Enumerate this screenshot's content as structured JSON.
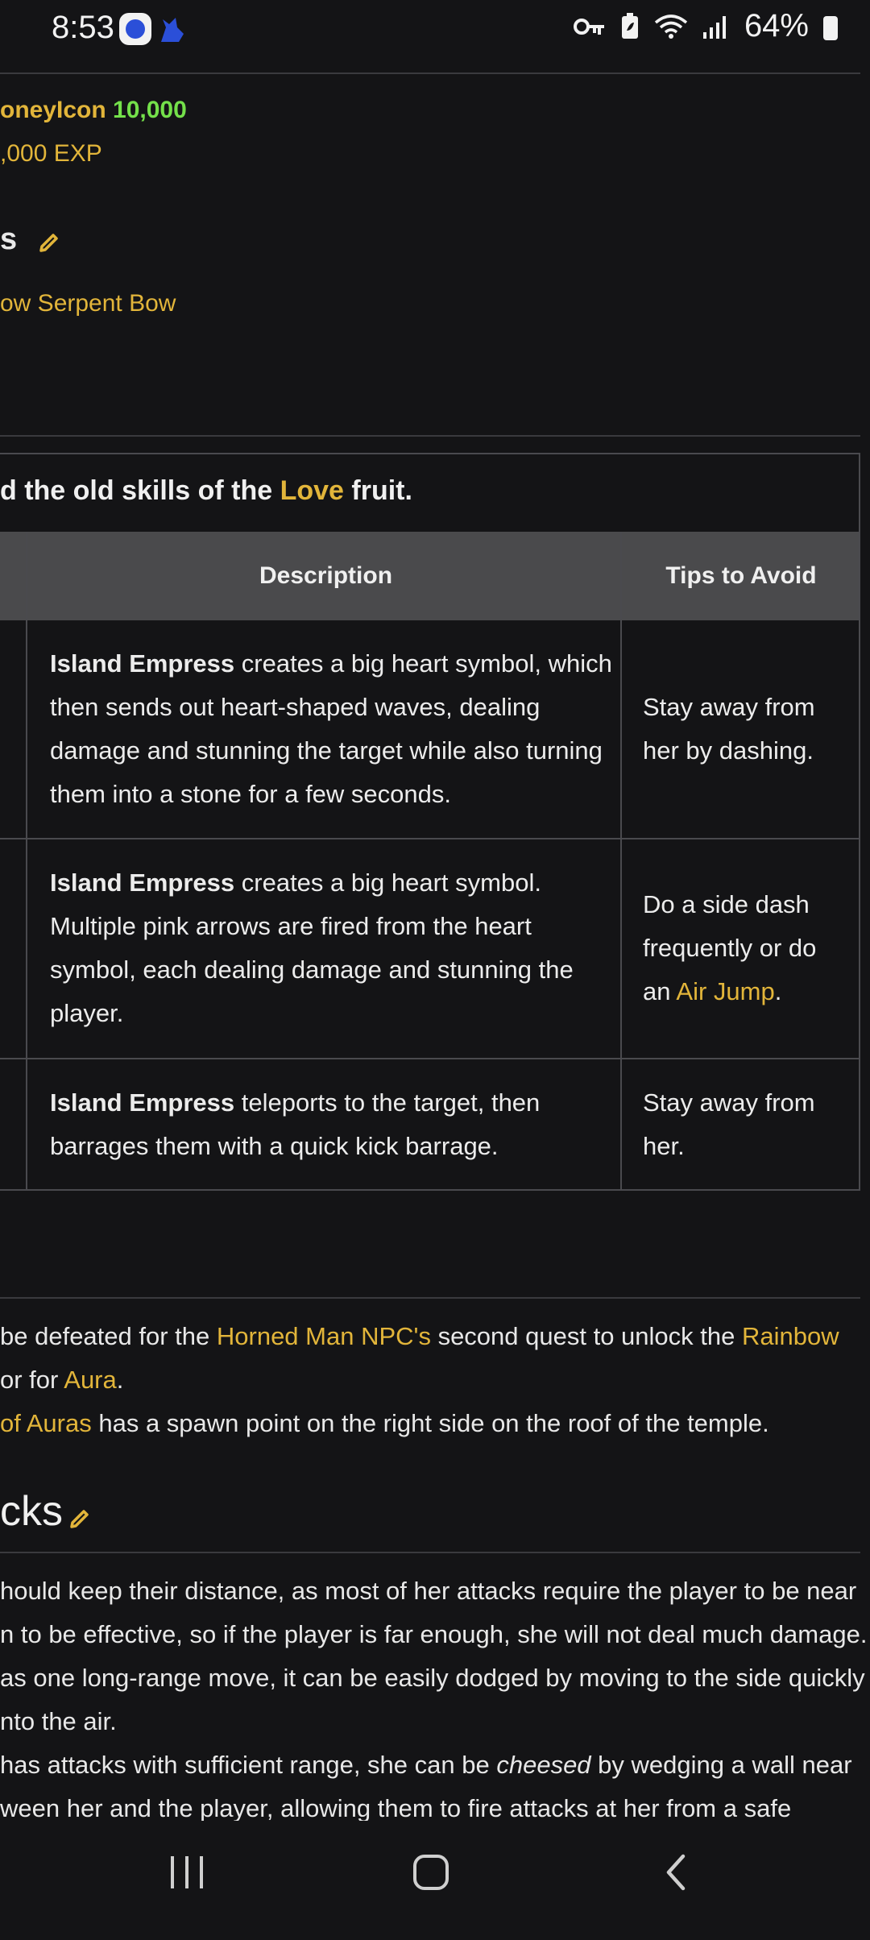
{
  "status_bar": {
    "time": "8:53",
    "battery": "64%",
    "icons": [
      "app-icon-1",
      "app-icon-2",
      "key-icon",
      "battery-saver-icon",
      "wifi-icon",
      "signal-icon",
      "battery-icon"
    ]
  },
  "rewards": {
    "money_label": "oneyIcon",
    "money_value": "10,000",
    "exp": ",000 EXP"
  },
  "drops_section": {
    "heading": "s",
    "item": "ow Serpent Bow"
  },
  "skills_box": {
    "intro_prefix": "d the old skills of the ",
    "intro_link": "Love",
    "intro_suffix": " fruit."
  },
  "table": {
    "headers": [
      "Description",
      "Tips to Avoid"
    ],
    "rows": [
      {
        "desc_bold": "Island Empress",
        "desc_rest": " creates a big heart symbol, which then sends out heart-shaped waves, dealing damage and stunning the target while also turning them into a stone for a few seconds.",
        "tip": "Stay away from her by dashing."
      },
      {
        "desc_bold": "Island Empress",
        "desc_rest": " creates a big heart symbol. Multiple pink arrows are fired from the heart symbol, each dealing damage and stunning the player.",
        "tip_prefix": "Do a side dash frequently or do an ",
        "tip_link": "Air Jump",
        "tip_suffix": "."
      },
      {
        "desc_bold": "Island Empress",
        "desc_rest": " teleports to the target, then barrages them with a quick kick barrage.",
        "tip": "Stay away from her."
      }
    ]
  },
  "trivia": {
    "line1_a": "be defeated for the ",
    "line1_link": "Horned Man NPC's",
    "line1_b": " second quest to unlock the ",
    "line1_link2": "Rainbow",
    "line2_a": "or for ",
    "line2_link": "Aura",
    "line2_b": ".",
    "line3_link": "of Auras",
    "line3_b": " has a spawn point on the right side on the roof of the temple."
  },
  "tricks_section": {
    "heading": "cks",
    "p1_l1": "hould keep their distance, as most of her attacks require the player to be near",
    "p1_l2": "n to be effective, so if the player is far enough, she will not deal much damage.",
    "p1_l3": "as one long-range move, it can be easily dodged by moving to the side quickly",
    "p1_l4": "nto the air.",
    "p2_l1_a": " has attacks with sufficient range, she can be ",
    "p2_l1_em": "cheesed",
    "p2_l1_b": " by wedging a wall near",
    "p2_l2": "ween her and the player, allowing them to fire attacks at her from a safe"
  },
  "nav_bar": {
    "items": [
      "recent-apps",
      "home",
      "back"
    ]
  }
}
